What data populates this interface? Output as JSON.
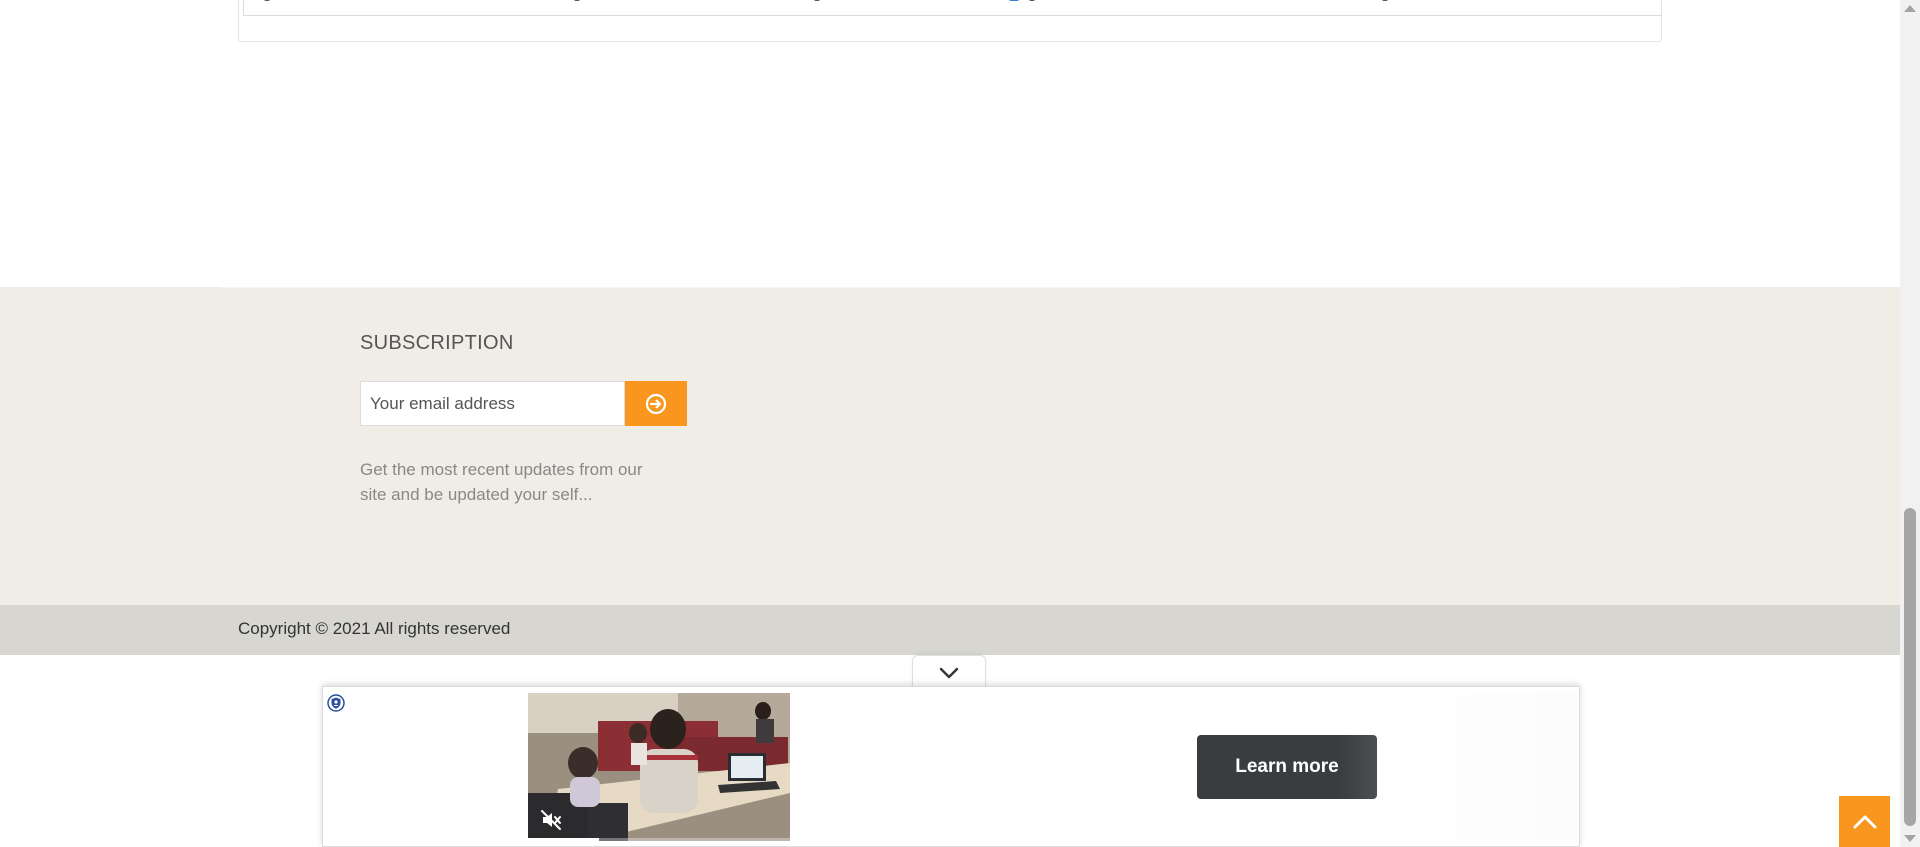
{
  "subscription": {
    "title": "SUBSCRIPTION",
    "email_placeholder": "Your email address",
    "description": "Get the most recent updates from our site and be updated your self..."
  },
  "footer": {
    "copyright": "Copyright © 2021 All rights reserved"
  },
  "ad": {
    "cta_label": "Learn more",
    "progress": 0.27
  },
  "icons": {
    "subscribe": "arrow-circle-right-icon",
    "back_to_top": "chevron-up-icon",
    "ad_toggle": "chevron-down-icon",
    "ad_privacy": "shield-icon",
    "ad_mute": "speaker-muted-icon"
  },
  "colors": {
    "accent": "#f8961d",
    "footer_bg": "#efede6",
    "footer_bottom_bg": "#d7d6d0",
    "cta_bg": "#3a3d40"
  }
}
